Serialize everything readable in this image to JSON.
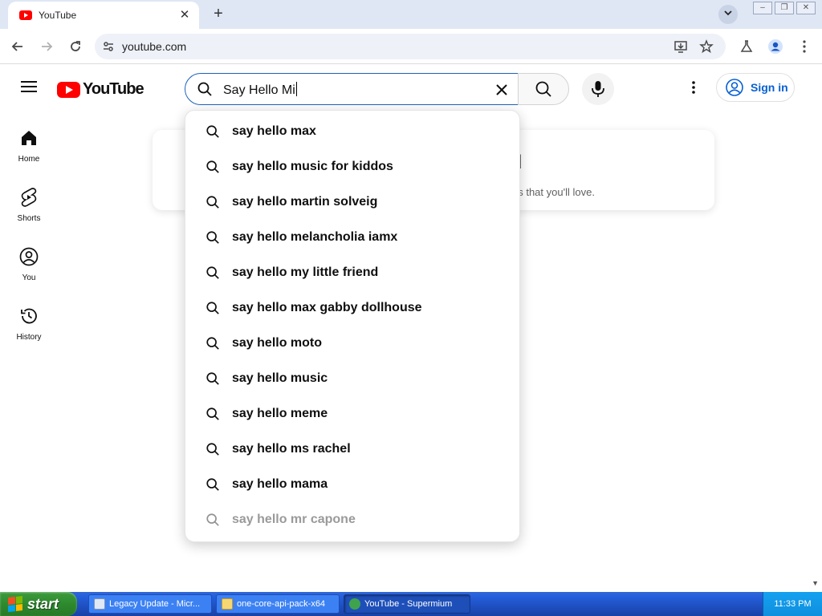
{
  "browser": {
    "tab_title": "YouTube",
    "tab_close": "✕",
    "new_tab": "+",
    "url": "youtube.com",
    "window_controls": [
      "minimize",
      "restore",
      "close"
    ]
  },
  "youtube": {
    "logo_text": "YouTube",
    "search_query": "Say Hello Mi",
    "sign_in_label": "Sign in",
    "guide": [
      {
        "label": "Home",
        "icon": "home-icon"
      },
      {
        "label": "Shorts",
        "icon": "shorts-icon"
      },
      {
        "label": "You",
        "icon": "you-icon"
      },
      {
        "label": "History",
        "icon": "history-icon"
      }
    ],
    "card": {
      "title_visible": "rted",
      "subtitle_visible": "os that you'll love."
    },
    "suggestions": [
      "say hello max",
      "say hello music for kiddos",
      "say hello martin solveig",
      "say hello melancholia iamx",
      "say hello my little friend",
      "say hello max gabby dollhouse",
      "say hello moto",
      "say hello music",
      "say hello meme",
      "say hello ms rachel",
      "say hello mama",
      "say hello mr capone"
    ]
  },
  "taskbar": {
    "start_label": "start",
    "tasks": [
      {
        "label": "Legacy Update - Micr...",
        "active": false
      },
      {
        "label": "one-core-api-pack-x64",
        "active": false
      },
      {
        "label": "YouTube - Supermium",
        "active": true
      }
    ],
    "clock": "11:33 PM"
  },
  "colors": {
    "yt_red": "#ff0000",
    "link_blue": "#065fd4",
    "focus_blue": "#1c62b9",
    "xp_taskbar": "#245edb",
    "xp_start_green": "#2e8a2e"
  }
}
